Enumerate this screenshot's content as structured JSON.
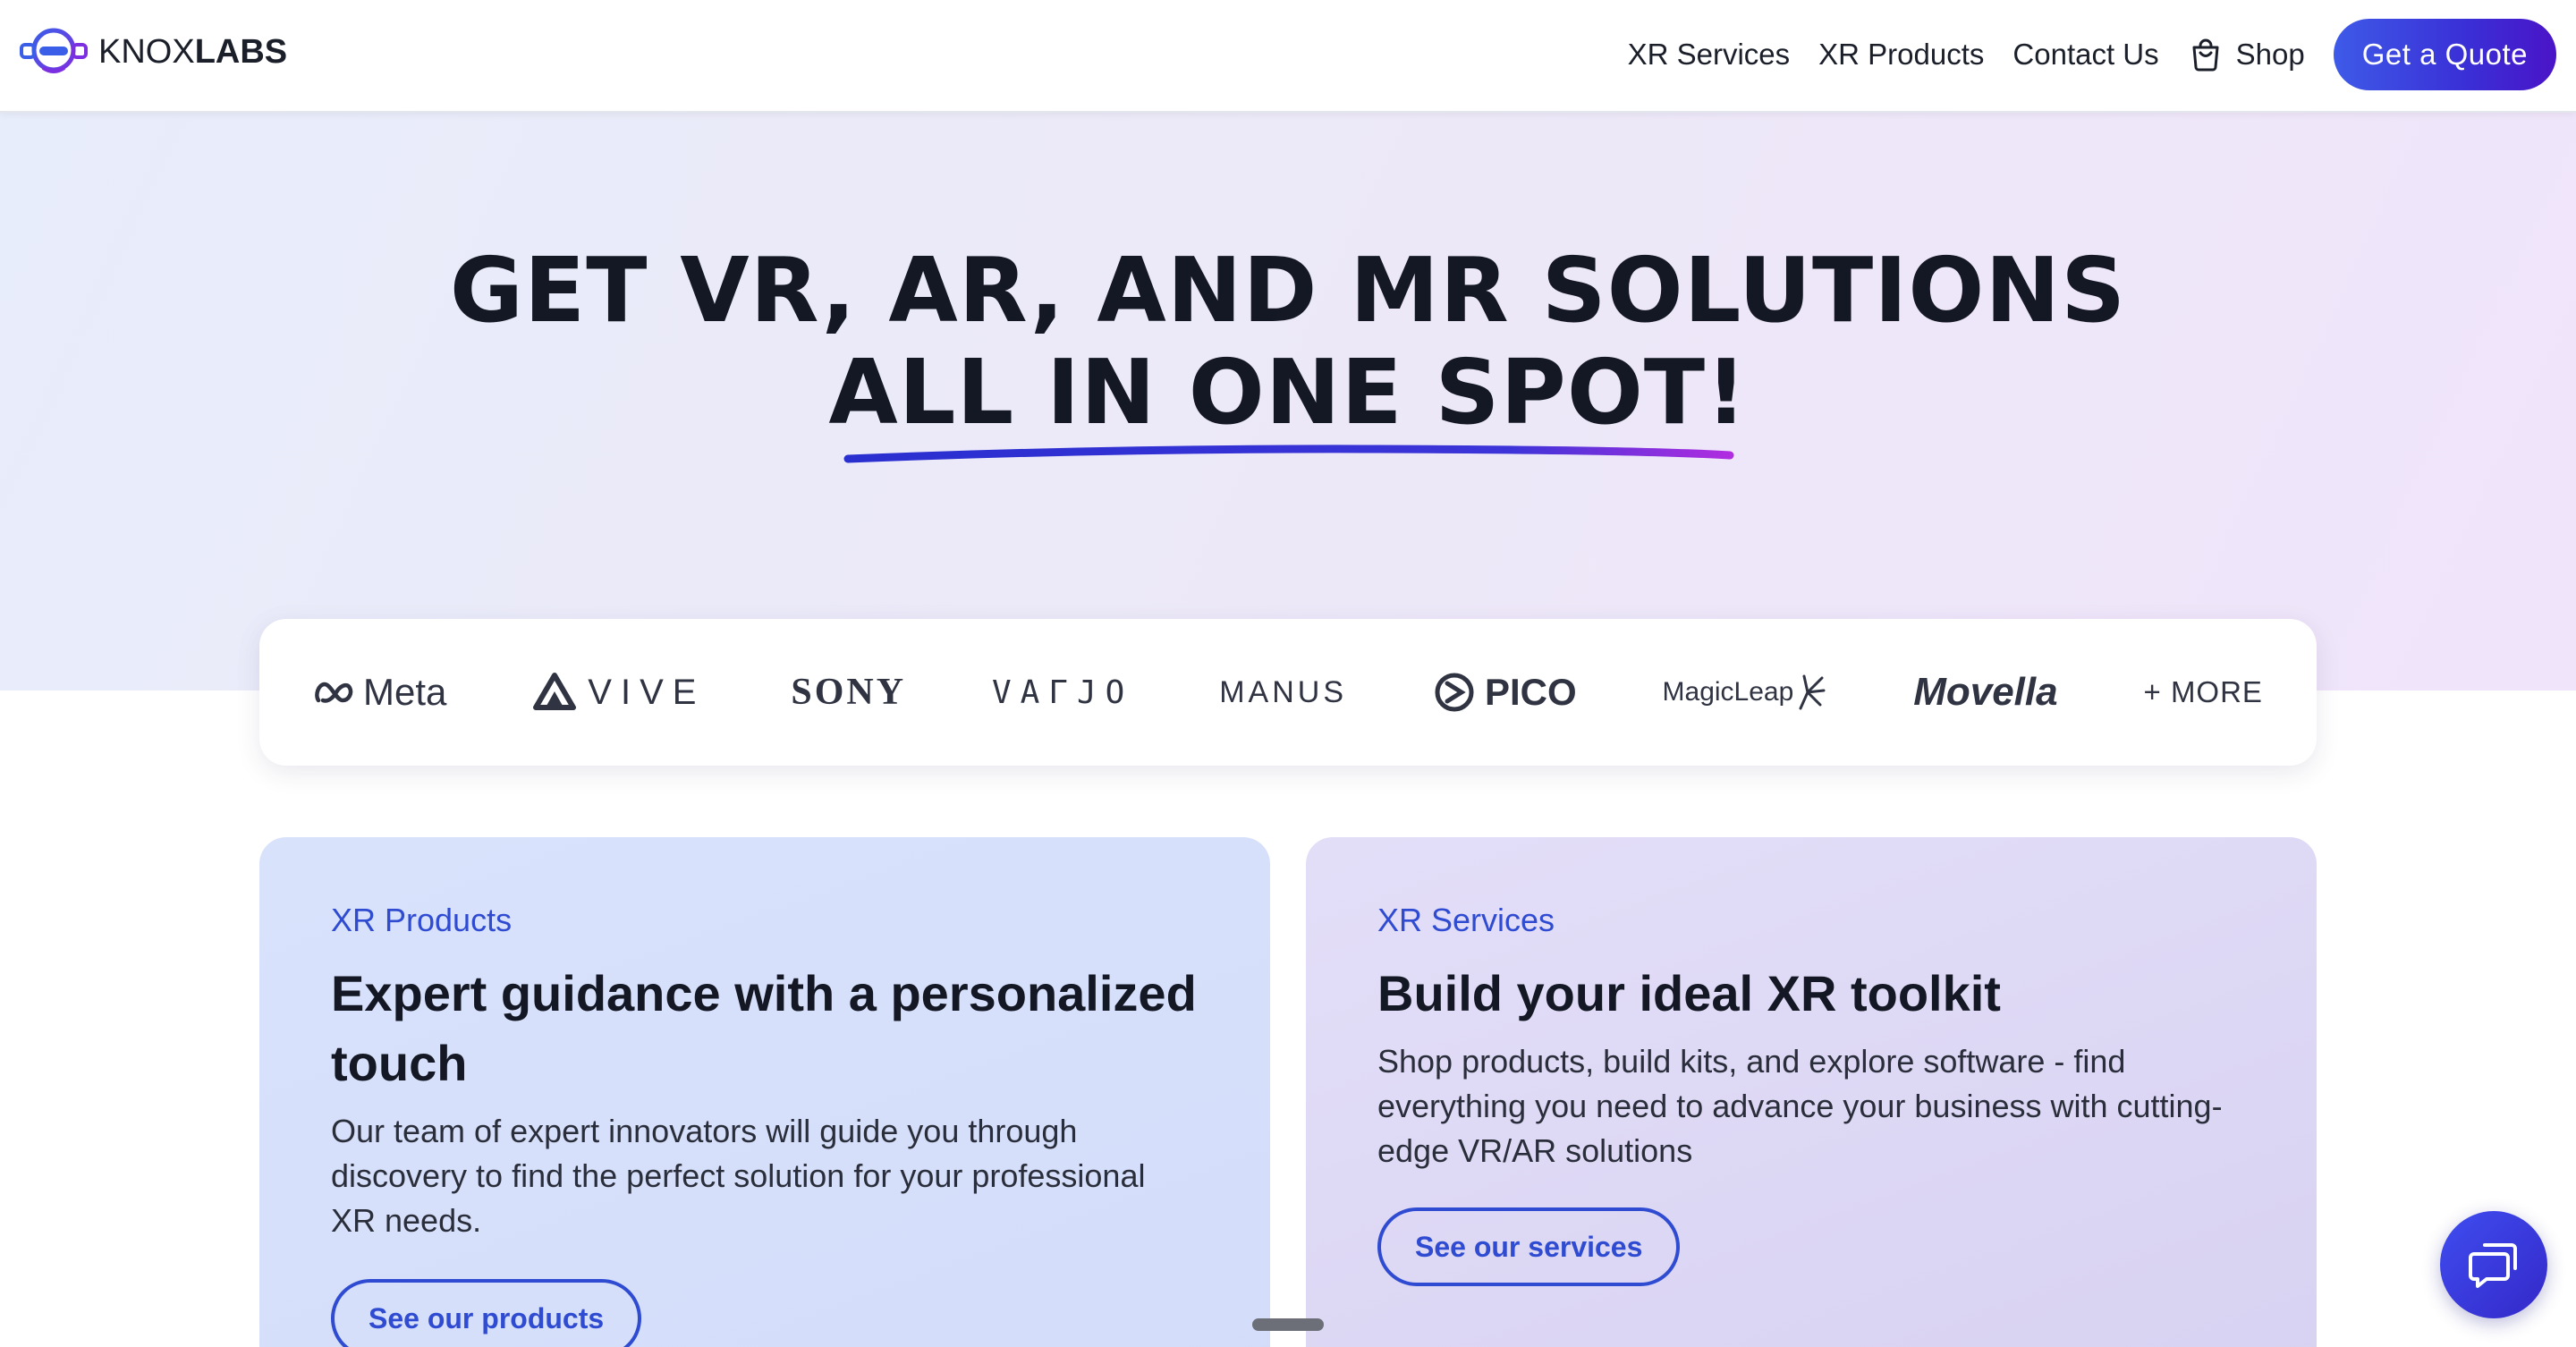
{
  "header": {
    "logo": {
      "text_light": "KNOX",
      "text_bold": "LABS",
      "icon": "headset-logo-icon"
    },
    "nav": [
      {
        "label": "XR Services"
      },
      {
        "label": "XR Products"
      },
      {
        "label": "Contact Us"
      }
    ],
    "shop": {
      "label": "Shop",
      "icon": "shopping-bag-icon"
    },
    "cta_label": "Get a Quote"
  },
  "hero": {
    "title_line1": "GET VR, AR, AND MR SOLUTIONS",
    "title_line2": "ALL IN ONE SPOT!"
  },
  "brands": {
    "items": [
      "Meta",
      "VIVE",
      "SONY",
      "VARJO",
      "MANUS",
      "PICO",
      "Magic Leap",
      "Movella"
    ],
    "display": {
      "meta": "Meta",
      "vive": "VIVE",
      "sony": "SONY",
      "varjo": "VAГJO",
      "manus": "MANUS",
      "pico": "PICO",
      "magicleap": "MagicLeap",
      "movella": "Movella"
    },
    "more_label": "+ MORE"
  },
  "cards": [
    {
      "eyebrow": "XR Products",
      "title": "Expert guidance with a personalized touch",
      "text": "Our team of expert innovators will guide you through discovery to find the perfect solution for your professional XR needs.",
      "button_label": "See our products"
    },
    {
      "eyebrow": "XR Services",
      "title": "Build your ideal XR toolkit",
      "text": "Shop products, build kits, and explore software - find everything you need to advance your business with cutting-edge VR/AR solutions",
      "button_label": "See our services"
    }
  ],
  "chat": {
    "icon": "chat-bubble-icon"
  },
  "colors": {
    "accent": "#2e4bd1",
    "cta_gradient_start": "#3e5ae8",
    "cta_gradient_end": "#4a14c7",
    "underline_start": "#2a2fd0",
    "underline_end": "#b02de0",
    "text_dark": "#141824"
  }
}
